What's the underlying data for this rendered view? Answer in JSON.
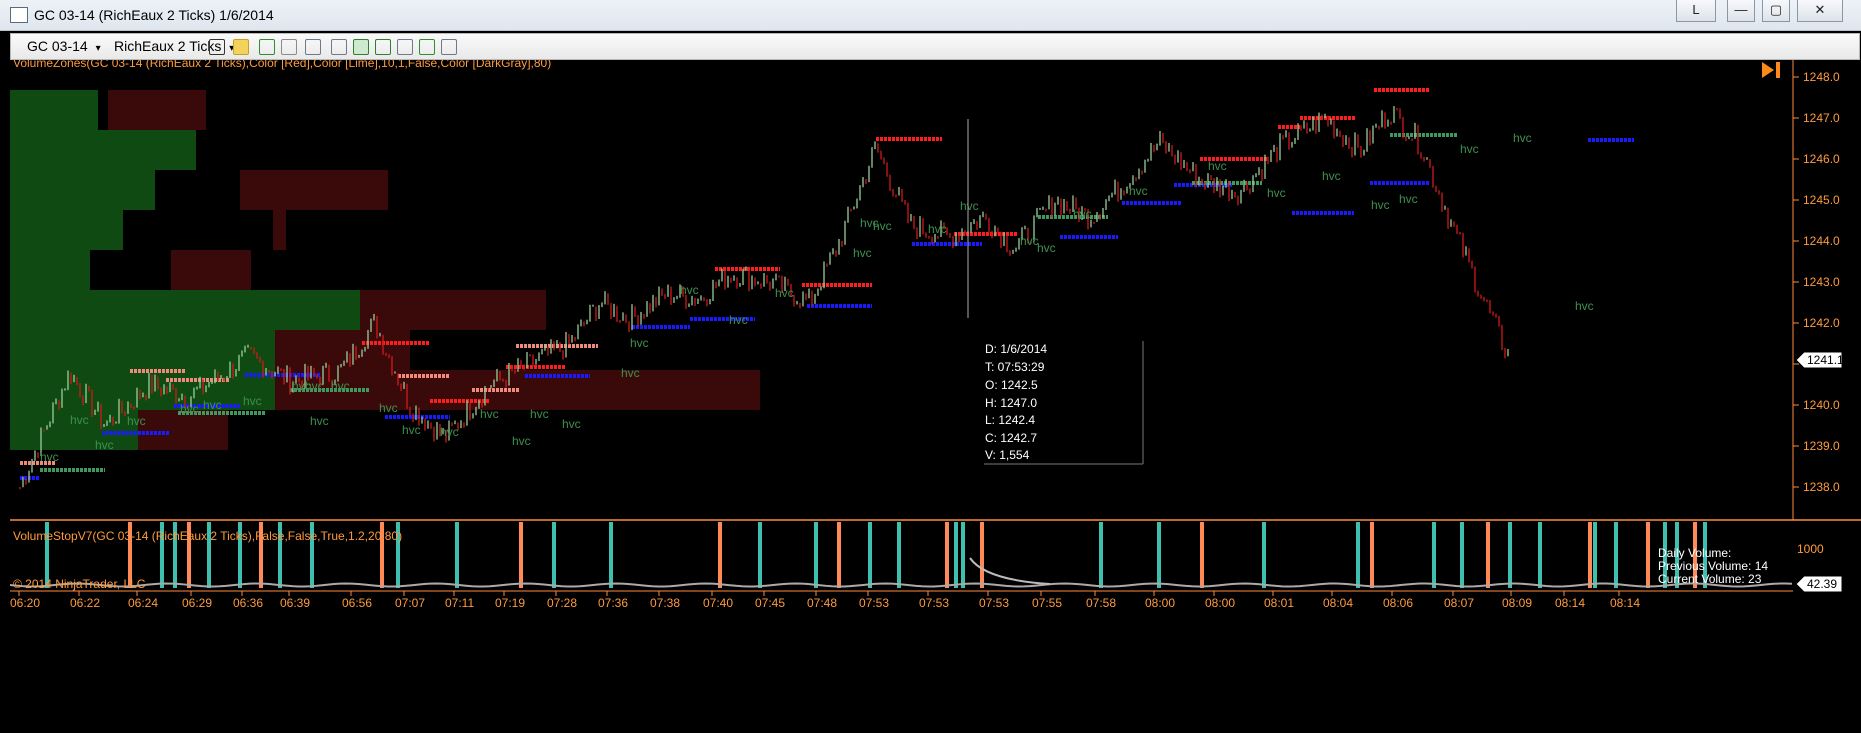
{
  "window": {
    "title": "GC 03-14 (RichEaux 2 Ticks)  1/6/2014",
    "buttons": {
      "link": "L",
      "minimize": "—",
      "maximize": "▢",
      "close": "✕"
    }
  },
  "toolbar": {
    "instrument": "GC 03-14",
    "period": "RichEaux 2 Ticks",
    "dropdown_glyph": "▾"
  },
  "indicators": {
    "main_label": "VolumeZones(GC 03-14 (RichEaux 2 Ticks),Color [Red],Color [Lime],10,1,False,Color [DarkGray],80)",
    "sub_label": "VolumeStopV7(GC 03-14 (RichEaux 2 Ticks),False,False,True,1.2,20,80)",
    "copyright": "© 2014 NinjaTrader, LLC"
  },
  "price_axis": {
    "labels": [
      "1248.0",
      "1247.0",
      "1246.0",
      "1245.0",
      "1244.0",
      "1243.0",
      "1242.0",
      "1241.0",
      "1240.0",
      "1239.0",
      "1238.0"
    ],
    "current_price": "1241.1"
  },
  "volume_axis": {
    "label_1000": "1000",
    "current": "42.39"
  },
  "time_axis": [
    "06:20",
    "06:22",
    "06:24",
    "06:29",
    "06:36",
    "06:39",
    "06:56",
    "07:07",
    "07:11",
    "07:19",
    "07:28",
    "07:36",
    "07:38",
    "07:40",
    "07:45",
    "07:48",
    "07:53",
    "07:53",
    "07:53",
    "07:55",
    "07:58",
    "08:00",
    "08:00",
    "08:01",
    "08:04",
    "08:06",
    "08:07",
    "08:09",
    "08:14",
    "08:14"
  ],
  "data_box": {
    "date": "D: 1/6/2014",
    "time": "T: 07:53:29",
    "open": "O: 1242.5",
    "high": "H: 1247.0",
    "low": "L: 1242.4",
    "close": "C: 1242.7",
    "volume": "V: 1,554"
  },
  "volume_info": {
    "daily": "Daily Volume:",
    "previous": "Previous Volume: 14",
    "current": "Current Volume: 23"
  },
  "hvc_label": "hvc",
  "colors": {
    "background": "#000000",
    "up_bar": "#9acd9a",
    "down_bar": "#d11a1a",
    "resistance": "#ff1e1e",
    "support": "#1a1aff",
    "zone_green": "#0e4a12",
    "zone_red": "#3a0a0a",
    "axis_text": "#ff9a3c",
    "hvc_text": "#3f8f4f",
    "volume_teal": "#3fbfb0",
    "volume_orange": "#ff8a55"
  }
}
